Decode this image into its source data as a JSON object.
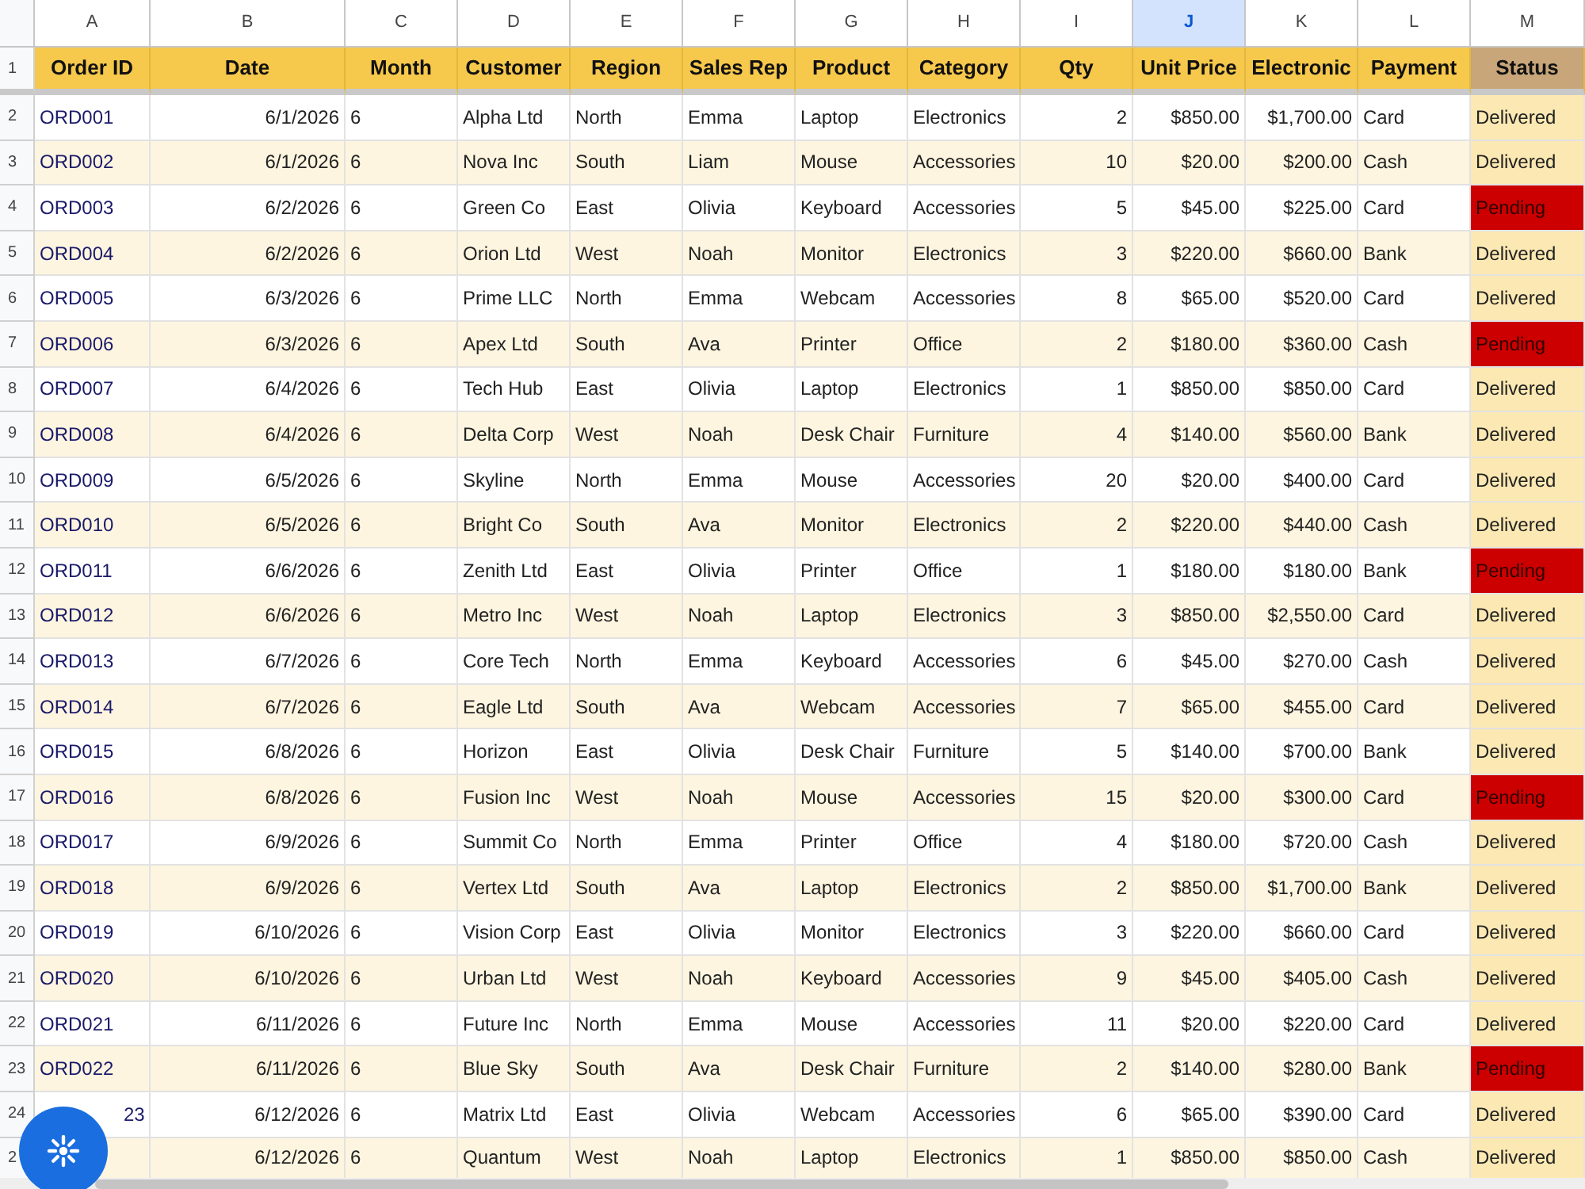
{
  "columns": [
    {
      "letter": "A",
      "heading": "Order ID",
      "kind": "text",
      "selected": false,
      "color": "#f6c84c"
    },
    {
      "letter": "B",
      "heading": "Date",
      "kind": "number",
      "selected": false,
      "color": "#f6c84c"
    },
    {
      "letter": "C",
      "heading": "Month",
      "kind": "text",
      "selected": false,
      "color": "#f6c84c"
    },
    {
      "letter": "D",
      "heading": "Customer",
      "kind": "text",
      "selected": false,
      "color": "#f6c84c"
    },
    {
      "letter": "E",
      "heading": "Region",
      "kind": "text",
      "selected": false,
      "color": "#f6c84c"
    },
    {
      "letter": "F",
      "heading": "Sales Rep",
      "kind": "text",
      "selected": false,
      "color": "#f6c84c"
    },
    {
      "letter": "G",
      "heading": "Product",
      "kind": "text",
      "selected": false,
      "color": "#f6c84c"
    },
    {
      "letter": "H",
      "heading": "Category",
      "kind": "text",
      "selected": false,
      "color": "#f6c84c"
    },
    {
      "letter": "I",
      "heading": "Qty",
      "kind": "number",
      "selected": false,
      "color": "#f6c84c"
    },
    {
      "letter": "J",
      "heading": "Unit Price",
      "kind": "number",
      "selected": true,
      "color": "#f6c84c"
    },
    {
      "letter": "K",
      "heading": "Electronic",
      "kind": "number",
      "selected": false,
      "color": "#f6c84c"
    },
    {
      "letter": "L",
      "heading": "Payment",
      "kind": "text",
      "selected": false,
      "color": "#f6c84c"
    },
    {
      "letter": "M",
      "heading": "Status",
      "kind": "status",
      "selected": false,
      "color": "#c8a679"
    }
  ],
  "header_row_number": "1",
  "rows": [
    {
      "number": "2",
      "cells": [
        "ORD001",
        "6/1/2026",
        "6",
        "Alpha Ltd",
        "North",
        "Emma",
        "Laptop",
        "Electronics",
        "2",
        "$850.00",
        "$1,700.00",
        "Card",
        "Delivered"
      ],
      "color": "#fce8b2"
    },
    {
      "number": "3",
      "cells": [
        "ORD002",
        "6/1/2026",
        "6",
        "Nova Inc",
        "South",
        "Liam",
        "Mouse",
        "Accessories",
        "10",
        "$20.00",
        "$200.00",
        "Cash",
        "Delivered"
      ],
      "color": "#fce8b2"
    },
    {
      "number": "4",
      "cells": [
        "ORD003",
        "6/2/2026",
        "6",
        "Green Co",
        "East",
        "Olivia",
        "Keyboard",
        "Accessories",
        "5",
        "$45.00",
        "$225.00",
        "Card",
        "Pending"
      ],
      "color": "#cc0000"
    },
    {
      "number": "5",
      "cells": [
        "ORD004",
        "6/2/2026",
        "6",
        "Orion Ltd",
        "West",
        "Noah",
        "Monitor",
        "Electronics",
        "3",
        "$220.00",
        "$660.00",
        "Bank",
        "Delivered"
      ],
      "color": "#fce8b2"
    },
    {
      "number": "6",
      "cells": [
        "ORD005",
        "6/3/2026",
        "6",
        "Prime LLC",
        "North",
        "Emma",
        "Webcam",
        "Accessories",
        "8",
        "$65.00",
        "$520.00",
        "Card",
        "Delivered"
      ],
      "color": "#fce8b2"
    },
    {
      "number": "7",
      "cells": [
        "ORD006",
        "6/3/2026",
        "6",
        "Apex Ltd",
        "South",
        "Ava",
        "Printer",
        "Office",
        "2",
        "$180.00",
        "$360.00",
        "Cash",
        "Pending"
      ],
      "color": "#cc0000"
    },
    {
      "number": "8",
      "cells": [
        "ORD007",
        "6/4/2026",
        "6",
        "Tech Hub",
        "East",
        "Olivia",
        "Laptop",
        "Electronics",
        "1",
        "$850.00",
        "$850.00",
        "Card",
        "Delivered"
      ],
      "color": "#fce8b2"
    },
    {
      "number": "9",
      "cells": [
        "ORD008",
        "6/4/2026",
        "6",
        "Delta Corp",
        "West",
        "Noah",
        "Desk Chair",
        "Furniture",
        "4",
        "$140.00",
        "$560.00",
        "Bank",
        "Delivered"
      ],
      "color": "#fce8b2"
    },
    {
      "number": "10",
      "cells": [
        "ORD009",
        "6/5/2026",
        "6",
        "Skyline",
        "North",
        "Emma",
        "Mouse",
        "Accessories",
        "20",
        "$20.00",
        "$400.00",
        "Card",
        "Delivered"
      ],
      "color": "#fce8b2"
    },
    {
      "number": "11",
      "cells": [
        "ORD010",
        "6/5/2026",
        "6",
        "Bright Co",
        "South",
        "Ava",
        "Monitor",
        "Electronics",
        "2",
        "$220.00",
        "$440.00",
        "Cash",
        "Delivered"
      ],
      "color": "#fce8b2"
    },
    {
      "number": "12",
      "cells": [
        "ORD011",
        "6/6/2026",
        "6",
        "Zenith Ltd",
        "East",
        "Olivia",
        "Printer",
        "Office",
        "1",
        "$180.00",
        "$180.00",
        "Bank",
        "Pending"
      ],
      "color": "#cc0000"
    },
    {
      "number": "13",
      "cells": [
        "ORD012",
        "6/6/2026",
        "6",
        "Metro Inc",
        "West",
        "Noah",
        "Laptop",
        "Electronics",
        "3",
        "$850.00",
        "$2,550.00",
        "Card",
        "Delivered"
      ],
      "color": "#fce8b2"
    },
    {
      "number": "14",
      "cells": [
        "ORD013",
        "6/7/2026",
        "6",
        "Core Tech",
        "North",
        "Emma",
        "Keyboard",
        "Accessories",
        "6",
        "$45.00",
        "$270.00",
        "Cash",
        "Delivered"
      ],
      "color": "#fce8b2"
    },
    {
      "number": "15",
      "cells": [
        "ORD014",
        "6/7/2026",
        "6",
        "Eagle Ltd",
        "South",
        "Ava",
        "Webcam",
        "Accessories",
        "7",
        "$65.00",
        "$455.00",
        "Card",
        "Delivered"
      ],
      "color": "#fce8b2"
    },
    {
      "number": "16",
      "cells": [
        "ORD015",
        "6/8/2026",
        "6",
        "Horizon",
        "East",
        "Olivia",
        "Desk Chair",
        "Furniture",
        "5",
        "$140.00",
        "$700.00",
        "Bank",
        "Delivered"
      ],
      "color": "#fce8b2"
    },
    {
      "number": "17",
      "cells": [
        "ORD016",
        "6/8/2026",
        "6",
        "Fusion Inc",
        "West",
        "Noah",
        "Mouse",
        "Accessories",
        "15",
        "$20.00",
        "$300.00",
        "Card",
        "Pending"
      ],
      "color": "#cc0000"
    },
    {
      "number": "18",
      "cells": [
        "ORD017",
        "6/9/2026",
        "6",
        "Summit Co",
        "North",
        "Emma",
        "Printer",
        "Office",
        "4",
        "$180.00",
        "$720.00",
        "Cash",
        "Delivered"
      ],
      "color": "#fce8b2"
    },
    {
      "number": "19",
      "cells": [
        "ORD018",
        "6/9/2026",
        "6",
        "Vertex Ltd",
        "South",
        "Ava",
        "Laptop",
        "Electronics",
        "2",
        "$850.00",
        "$1,700.00",
        "Bank",
        "Delivered"
      ],
      "color": "#fce8b2"
    },
    {
      "number": "20",
      "cells": [
        "ORD019",
        "6/10/2026",
        "6",
        "Vision Corp",
        "East",
        "Olivia",
        "Monitor",
        "Electronics",
        "3",
        "$220.00",
        "$660.00",
        "Card",
        "Delivered"
      ],
      "color": "#fce8b2"
    },
    {
      "number": "21",
      "cells": [
        "ORD020",
        "6/10/2026",
        "6",
        "Urban Ltd",
        "West",
        "Noah",
        "Keyboard",
        "Accessories",
        "9",
        "$45.00",
        "$405.00",
        "Cash",
        "Delivered"
      ],
      "color": "#fce8b2"
    },
    {
      "number": "22",
      "cells": [
        "ORD021",
        "6/11/2026",
        "6",
        "Future Inc",
        "North",
        "Emma",
        "Mouse",
        "Accessories",
        "11",
        "$20.00",
        "$220.00",
        "Card",
        "Delivered"
      ],
      "color": "#fce8b2"
    },
    {
      "number": "23",
      "cells": [
        "ORD022",
        "6/11/2026",
        "6",
        "Blue Sky",
        "South",
        "Ava",
        "Desk Chair",
        "Furniture",
        "2",
        "$140.00",
        "$280.00",
        "Bank",
        "Pending"
      ],
      "color": "#cc0000"
    },
    {
      "number": "24",
      "cells": [
        "23",
        "6/12/2026",
        "6",
        "Matrix Ltd",
        "East",
        "Olivia",
        "Webcam",
        "Accessories",
        "6",
        "$65.00",
        "$390.00",
        "Card",
        "Delivered"
      ],
      "color": "#fce8b2",
      "covered": true
    },
    {
      "number": "2",
      "cells": [
        null,
        "6/12/2026",
        "6",
        "Quantum",
        "West",
        "Noah",
        "Laptop",
        "Electronics",
        "1",
        "$850.00",
        "$850.00",
        "Cash",
        "Delivered"
      ],
      "color": "#fce8b2",
      "covered": true
    }
  ]
}
